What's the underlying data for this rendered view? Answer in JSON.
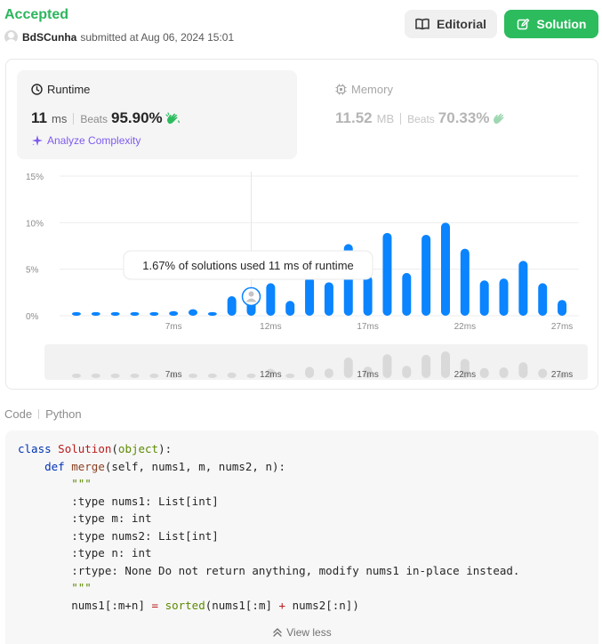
{
  "header": {
    "status": "Accepted",
    "username": "BdSCunha",
    "submitted_text": "submitted at Aug 06, 2024 15:01",
    "editorial_label": "Editorial",
    "solution_label": "Solution"
  },
  "runtime": {
    "title": "Runtime",
    "value": "11",
    "unit": "ms",
    "beats_label": "Beats",
    "beats": "95.90%",
    "analyze_label": "Analyze Complexity"
  },
  "memory": {
    "title": "Memory",
    "value": "11.52",
    "unit": "MB",
    "beats_label": "Beats",
    "beats": "70.33%"
  },
  "tooltip": "1.67% of solutions used 11 ms of runtime",
  "chart_data": {
    "type": "bar",
    "y_ticks": [
      0,
      5,
      10,
      15
    ],
    "y_tick_labels": [
      "0%",
      "5%",
      "10%",
      "15%"
    ],
    "ylim": [
      0,
      15
    ],
    "x_tick_labels": [
      "7ms",
      "12ms",
      "17ms",
      "22ms",
      "27ms"
    ],
    "x_tick_values": [
      7,
      12,
      17,
      22,
      27
    ],
    "x": [
      2,
      3,
      4,
      5,
      6,
      7,
      8,
      9,
      10,
      11,
      12,
      13,
      14,
      15,
      16,
      17,
      18,
      19,
      20,
      21,
      22,
      23,
      24,
      25,
      26,
      27
    ],
    "values": [
      0.4,
      0.4,
      0.4,
      0.4,
      0.4,
      0.5,
      0.7,
      0.4,
      2.1,
      1.67,
      3.5,
      1.6,
      4.2,
      3.6,
      7.7,
      4.3,
      8.9,
      4.6,
      8.7,
      10.0,
      7.2,
      3.8,
      4.0,
      5.9,
      3.5,
      1.7
    ],
    "highlight_x": 11,
    "grid": true
  },
  "code": {
    "label": "Code",
    "language": "Python",
    "lines": [
      "class Solution(object):",
      "    def merge(self, nums1, m, nums2, n):",
      "        \"\"\"",
      "        :type nums1: List[int]",
      "        :type m: int",
      "        :type nums2: List[int]",
      "        :type n: int",
      "        :rtype: None Do not return anything, modify nums1 in-place instead.",
      "        \"\"\"",
      "        nums1[:m+n] = sorted(nums1[:m] + nums2[:n])"
    ],
    "view_less": "View less"
  },
  "colors": {
    "accepted": "#2db55d",
    "bar": "#0a84ff",
    "solution_button": "#2cbb5d",
    "analyze": "#7e5bef"
  }
}
